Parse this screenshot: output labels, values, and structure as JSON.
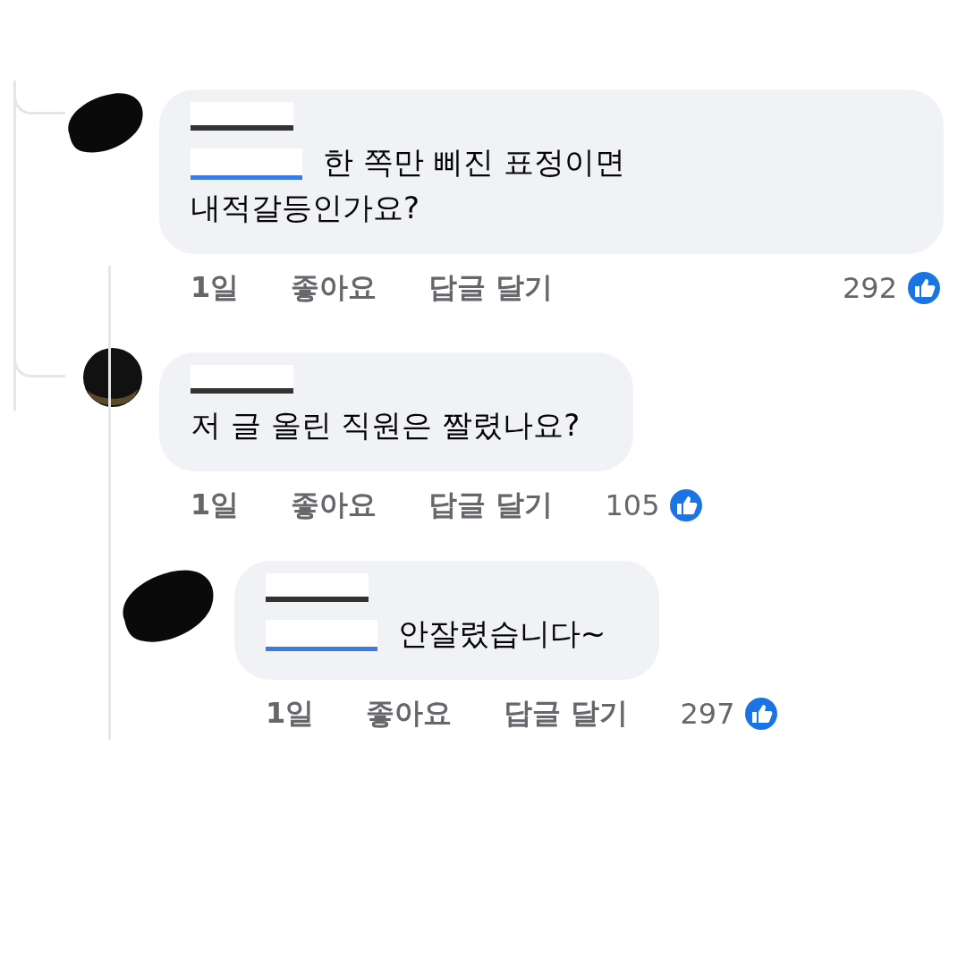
{
  "comments": [
    {
      "author": {
        "redacted": true
      },
      "avatar": {
        "kind": "blob"
      },
      "mention": {
        "redacted": true
      },
      "text": "한 쪽만 삐진 표정이면 내적갈등인가요?",
      "time": "1일",
      "like": "좋아요",
      "reply": "답글 달기",
      "reactions": "292"
    },
    {
      "author": {
        "redacted": true
      },
      "avatar": {
        "kind": "circle"
      },
      "text": "저 글 올린 직원은 짤렸나요?",
      "time": "1일",
      "like": "좋아요",
      "reply": "답글 달기",
      "reactions": "105",
      "replies": [
        {
          "author": {
            "redacted": true
          },
          "avatar": {
            "kind": "blob"
          },
          "mention": {
            "redacted": true
          },
          "text": "안잘렸습니다~",
          "time": "1일",
          "like": "좋아요",
          "reply": "답글 달기",
          "reactions": "297"
        }
      ]
    }
  ]
}
